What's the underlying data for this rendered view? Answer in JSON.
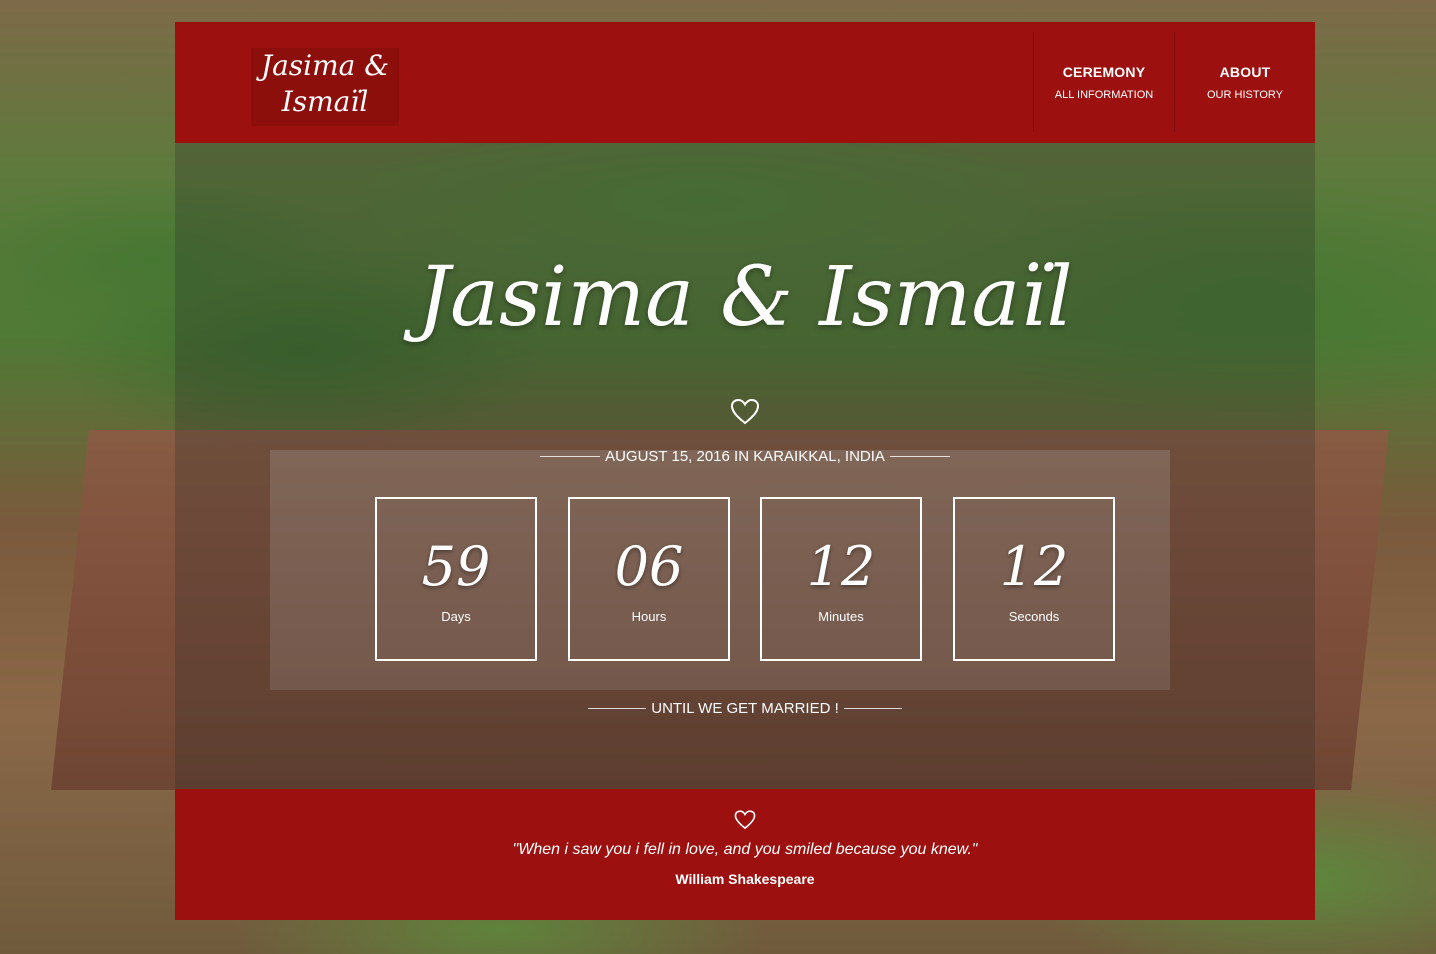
{
  "logo": {
    "line1": "Jasima &",
    "line2": "Ismaïl"
  },
  "nav": [
    {
      "title": "CEREMONY",
      "sub": "ALL INFORMATION"
    },
    {
      "title": "ABOUT",
      "sub": "OUR HISTORY"
    }
  ],
  "hero": {
    "couple_names": "Jasima & Ismaïl",
    "date_location": "AUGUST 15, 2016 IN KARAIKKAL, INDIA",
    "until": "UNTIL WE GET MARRIED !"
  },
  "countdown": [
    {
      "value": "59",
      "label": "Days"
    },
    {
      "value": "06",
      "label": "Hours"
    },
    {
      "value": "12",
      "label": "Minutes"
    },
    {
      "value": "12",
      "label": "Seconds"
    }
  ],
  "footer": {
    "quote": "\"When i saw you i fell in love, and you smiled because you knew.\"",
    "author": "William Shakespeare"
  },
  "icons": {
    "hero_heart": "heart-outline-icon",
    "footer_heart": "heart-outline-icon"
  },
  "colors": {
    "brand_red": "#9c1110",
    "text": "#ffffff"
  }
}
